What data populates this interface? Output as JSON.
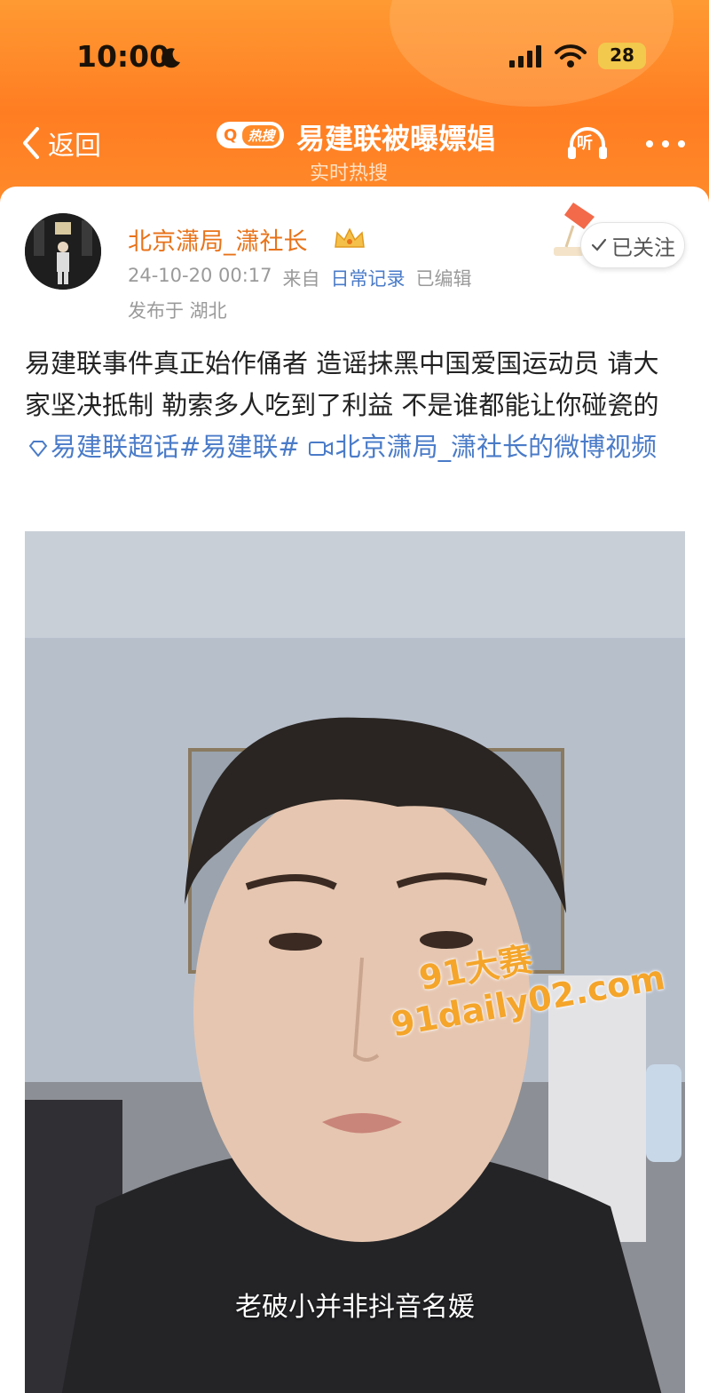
{
  "status_bar": {
    "time": "10:00",
    "battery_level": "28",
    "icons": [
      "moon-icon",
      "signal-icon",
      "wifi-icon",
      "battery-icon"
    ]
  },
  "nav": {
    "back_label": "返回",
    "hot_badge": "热搜",
    "title": "易建联被曝嫖娼",
    "subtitle": "实时热搜",
    "listen_label": "听"
  },
  "post": {
    "username": "北京潇局_潇社长",
    "timestamp": "24-10-20 00:17",
    "source_prefix": "来自",
    "source": "日常记录",
    "edited": "已编辑",
    "location": "发布于 湖北",
    "follow_label": "已关注",
    "text_plain": "易建联事件真正始作俑者 造谣抹黑中国爱国运动员 请大家坚决抵制 勒索多人吃到了利益 不是谁都能让你碰瓷的",
    "supertopic": "易建联超话",
    "hashtag": "#易建联#",
    "video_link": "北京潇局_潇社长的微博视频"
  },
  "video": {
    "subtitle": "老破小并非抖音名媛",
    "watermark_line1": "91大赛",
    "watermark_line2": "91daily02.com"
  },
  "colors": {
    "header_orange": "#ff7d22",
    "username_orange": "#e8731a",
    "link_blue": "#4a7bc8"
  }
}
